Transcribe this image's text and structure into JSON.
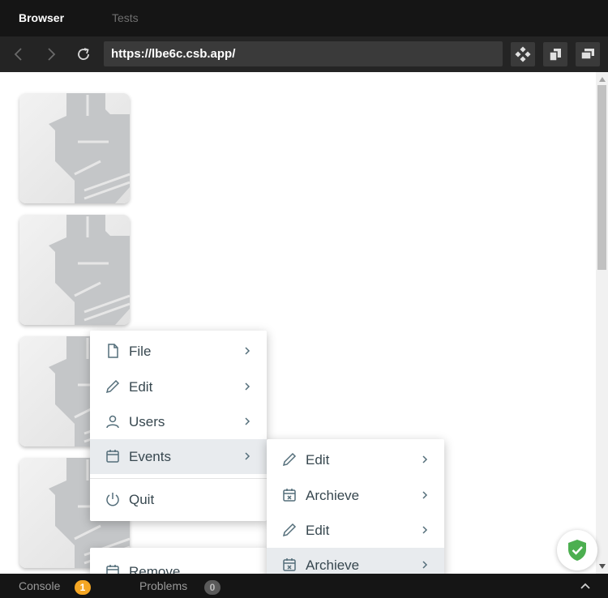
{
  "tabs": {
    "browser": "Browser",
    "tests": "Tests"
  },
  "toolbar": {
    "url": "https://lbe6c.csb.app/"
  },
  "menu": {
    "items": [
      {
        "label": "File",
        "icon": "file-icon"
      },
      {
        "label": "Edit",
        "icon": "pencil-icon"
      },
      {
        "label": "Users",
        "icon": "user-icon"
      },
      {
        "label": "Events",
        "icon": "calendar-icon"
      },
      {
        "label": "Quit",
        "icon": "power-icon"
      }
    ],
    "remove_label": "Remove"
  },
  "submenu": {
    "items": [
      {
        "label": "Edit",
        "icon": "pencil-icon"
      },
      {
        "label": "Archieve",
        "icon": "calendar-x-icon"
      },
      {
        "label": "Edit",
        "icon": "pencil-icon"
      },
      {
        "label": "Archieve",
        "icon": "calendar-x-icon"
      }
    ]
  },
  "bottom": {
    "console_label": "Console",
    "console_count": "1",
    "problems_label": "Problems",
    "problems_count": "0"
  },
  "colors": {
    "menu_text": "#37474f",
    "highlight": "#e8ebee",
    "console_badge": "#f5a623",
    "shield": "#4caf50"
  }
}
